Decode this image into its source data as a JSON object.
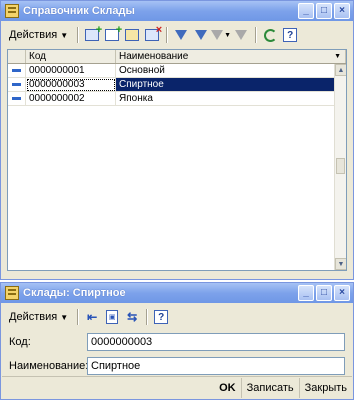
{
  "list_window": {
    "title": "Справочник Склады",
    "title_buttons": [
      "_",
      "□",
      "×"
    ],
    "toolbar": {
      "actions_label": "Действия",
      "icons": [
        "add-icon",
        "add-copy-icon",
        "edit-icon",
        "delete-icon",
        "filter-icon",
        "filter-by-value-icon",
        "filter-history-icon",
        "clear-filter-icon",
        "refresh-icon",
        "help-icon"
      ],
      "help_glyph": "?"
    },
    "table": {
      "columns": [
        "Код",
        "Наименование"
      ],
      "rows": [
        {
          "code": "0000000001",
          "name": "Основной",
          "selected": false
        },
        {
          "code": "0000000003",
          "name": "Спиртное",
          "selected": true
        },
        {
          "code": "0000000002",
          "name": "Японка",
          "selected": false
        }
      ]
    }
  },
  "item_window": {
    "title": "Склады: Спиртное",
    "title_buttons": [
      "_",
      "□",
      "×"
    ],
    "toolbar": {
      "actions_label": "Действия",
      "icons": [
        "go-to-list-icon",
        "structure-icon",
        "move-icon",
        "help-icon"
      ],
      "help_glyph": "?"
    },
    "fields": {
      "code_label": "Код:",
      "code_value": "0000000003",
      "name_label": "Наименование:",
      "name_value": "Спиртное"
    },
    "footer": {
      "ok": "OK",
      "save": "Записать",
      "close": "Закрыть"
    }
  }
}
